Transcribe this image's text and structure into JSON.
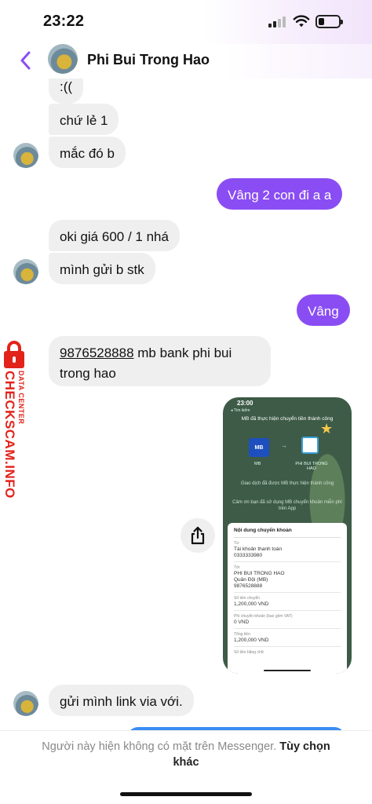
{
  "status_bar": {
    "time": "23:22",
    "battery_level": 0.3
  },
  "header": {
    "contact_name": "Phi Bui Trong Hao",
    "back_icon": "chevron-left-icon",
    "accent_color": "#8a4df3"
  },
  "messages": [
    {
      "direction": "in",
      "text": ":(("
    },
    {
      "direction": "in",
      "text": "chứ lẻ 1"
    },
    {
      "direction": "in",
      "text": "mắc đó b"
    },
    {
      "direction": "out",
      "text": "Vâng 2 con đi a a"
    },
    {
      "direction": "in",
      "text": "oki giá 600 / 1 nhá"
    },
    {
      "direction": "in",
      "text": "mình gửi b stk"
    },
    {
      "direction": "out",
      "text": "Vâng"
    },
    {
      "direction": "in",
      "account": "9876528888",
      "text": " mb bank phi bui trong hao"
    },
    {
      "direction": "in",
      "text": "gửi mình link via với."
    }
  ],
  "attachment": {
    "time": "23:00",
    "back_label": "◂ Tìm kiếm",
    "title": "MB đã thực hiện chuyển tiền thành công",
    "bank_logo": "MB",
    "bank_label": "MB",
    "recipient_label": "PHI BUI TRONG HAO",
    "message1": "Giao dịch đã được MB thực hiện thành công",
    "message2": "Cảm ơn bạn đã sử dụng MB chuyển khoản miễn phí trên App",
    "card_title": "Nội dung chuyển khoản",
    "rows": [
      {
        "label": "Từ",
        "value": "Tài khoản thanh toán\n0333333980"
      },
      {
        "label": "Tới",
        "value": "PHI BUI TRONG HAO\nQuân Đội (MB)\n9876528888"
      },
      {
        "label": "Số tiền chuyển",
        "value": "1,200,000 VND"
      },
      {
        "label": "Phí chuyển khoản (bao gồm VAT)",
        "value": "0 VND"
      },
      {
        "label": "Tổng tiền",
        "value": "1,200,000 VND"
      },
      {
        "label": "Số tiền bằng chữ",
        "value": ""
      }
    ]
  },
  "share_icon": "share-icon",
  "watermark": {
    "main": "CHECKSCAM.INFO",
    "sub": "DATA CENTER",
    "color": "#e2231a"
  },
  "footer": {
    "notice": "Người này hiện không có mặt trên Messenger.",
    "action": "Tùy chọn khác"
  }
}
